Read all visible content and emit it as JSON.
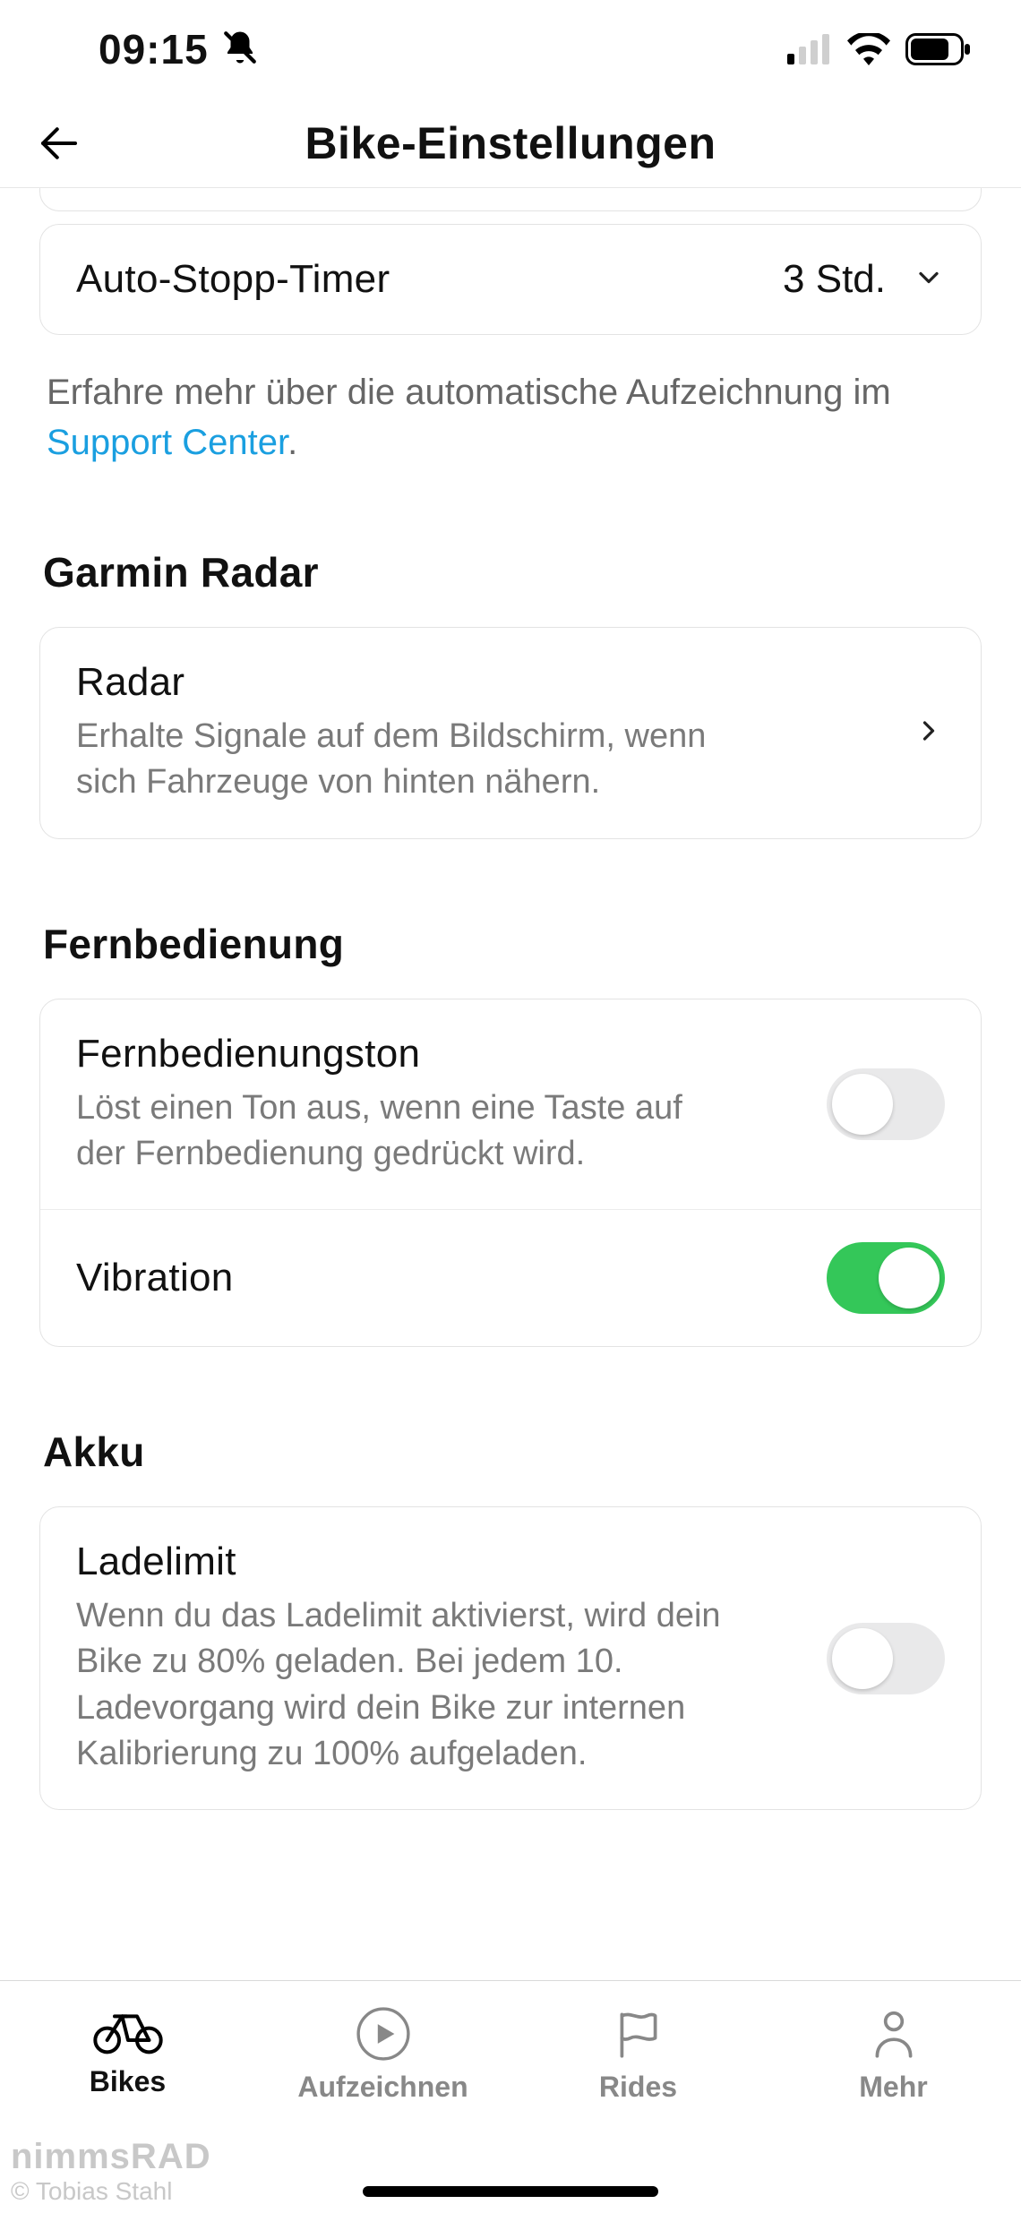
{
  "status": {
    "time": "09:15"
  },
  "header": {
    "title": "Bike-Einstellungen"
  },
  "auto_stop": {
    "label": "Auto-Stopp-Timer",
    "value": "3 Std."
  },
  "help": {
    "prefix": "Erfahre mehr über die automatische Aufzeichnung im ",
    "link_text": "Support Center",
    "suffix": "."
  },
  "radar_section_title": "Garmin Radar",
  "radar": {
    "title": "Radar",
    "desc": "Erhalte Signale auf dem Bildschirm, wenn sich Fahrzeuge von hinten nähern."
  },
  "remote_section_title": "Fernbedienung",
  "remote_tone": {
    "title": "Fernbedienungston",
    "desc": "Löst einen Ton aus, wenn eine Taste auf der Fernbedienung gedrückt wird.",
    "enabled": false
  },
  "vibration": {
    "title": "Vibration",
    "enabled": true
  },
  "battery_section_title": "Akku",
  "charge_limit": {
    "title": "Ladelimit",
    "desc": "Wenn du das Ladelimit aktivierst, wird dein Bike zu 80% geladen. Bei jedem 10. Ladevorgang wird dein Bike zur internen Kalibrierung zu 100% aufgeladen.",
    "enabled": false
  },
  "tabs": {
    "bikes": "Bikes",
    "record": "Aufzeichnen",
    "rides": "Rides",
    "more": "Mehr"
  },
  "watermark": {
    "line1": "nimmsRAD",
    "line2": "© Tobias Stahl"
  }
}
